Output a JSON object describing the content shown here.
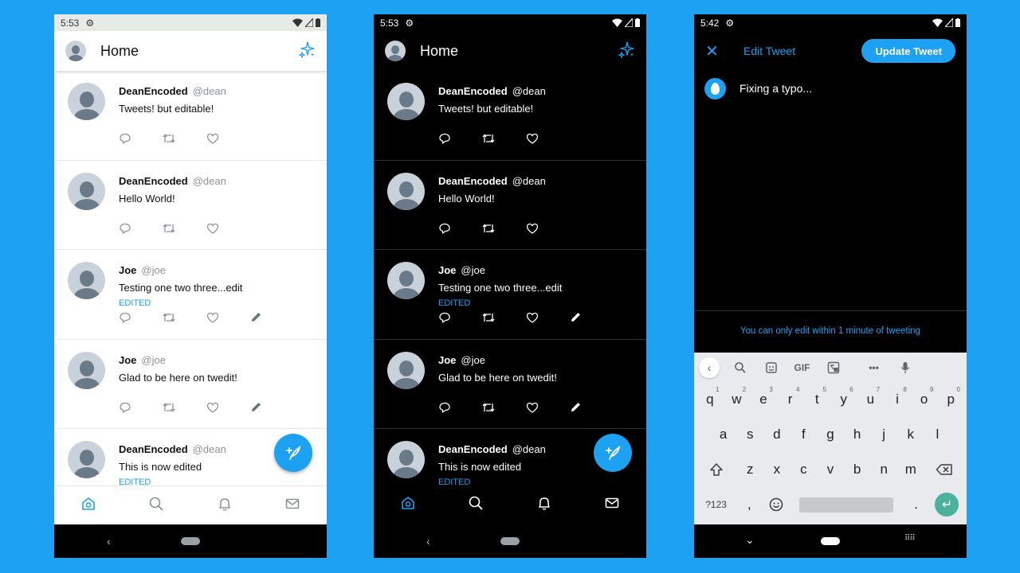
{
  "colors": {
    "accent": "#1da1f2",
    "background": "#1da1f2",
    "light_bg": "#ffffff",
    "dark_bg": "#000000"
  },
  "screen_light": {
    "status": {
      "time": "5:53"
    },
    "appbar": {
      "title": "Home"
    },
    "tweets": [
      {
        "name": "DeanEncoded",
        "handle": "@dean",
        "text": "Tweets! but editable!",
        "edited": "",
        "editable": false
      },
      {
        "name": "DeanEncoded",
        "handle": "@dean",
        "text": "Hello World!",
        "edited": "",
        "editable": false
      },
      {
        "name": "Joe",
        "handle": "@joe",
        "text": "Testing one two three...edit",
        "edited": "EDITED",
        "editable": true
      },
      {
        "name": "Joe",
        "handle": "@joe",
        "text": "Glad to be here on twedit!",
        "edited": "",
        "editable": true
      },
      {
        "name": "DeanEncoded",
        "handle": "@dean",
        "text": "This is now edited",
        "edited": "EDITED",
        "editable": false
      }
    ]
  },
  "screen_dark": {
    "status": {
      "time": "5:53"
    },
    "appbar": {
      "title": "Home"
    },
    "tweets": [
      {
        "name": "DeanEncoded",
        "handle": "@dean",
        "text": "Tweets! but editable!",
        "edited": ""
      },
      {
        "name": "DeanEncoded",
        "handle": "@dean",
        "text": "Hello World!",
        "edited": ""
      },
      {
        "name": "Joe",
        "handle": "@joe",
        "text": "Testing one two three...edit",
        "edited": "EDITED"
      },
      {
        "name": "Joe",
        "handle": "@joe",
        "text": "Glad to be here on twedit!",
        "edited": ""
      },
      {
        "name": "DeanEncoded",
        "handle": "@dean",
        "text": "This is now edited",
        "edited": "EDITED"
      }
    ]
  },
  "screen_edit": {
    "status": {
      "time": "5:42"
    },
    "title": "Edit Tweet",
    "update_label": "Update Tweet",
    "text": "Fixing a typo...",
    "hint": "You can only edit within 1 minute of tweeting",
    "keyboard": {
      "gif_label": "GIF",
      "row1": [
        {
          "k": "q",
          "n": "1"
        },
        {
          "k": "w",
          "n": "2"
        },
        {
          "k": "e",
          "n": "3"
        },
        {
          "k": "r",
          "n": "4"
        },
        {
          "k": "t",
          "n": "5"
        },
        {
          "k": "y",
          "n": "6"
        },
        {
          "k": "u",
          "n": "7"
        },
        {
          "k": "i",
          "n": "8"
        },
        {
          "k": "o",
          "n": "9"
        },
        {
          "k": "p",
          "n": "0"
        }
      ],
      "row2": [
        "a",
        "s",
        "d",
        "f",
        "g",
        "h",
        "j",
        "k",
        "l"
      ],
      "row3": [
        "z",
        "x",
        "c",
        "v",
        "b",
        "n",
        "m"
      ],
      "symbols_label": "?123",
      "comma": ",",
      "period": "."
    }
  },
  "icons": {
    "settings": "gear-icon",
    "compose": "sparkle-icon",
    "reply": "reply-icon",
    "retweet": "retweet-icon",
    "like": "heart-icon",
    "edit": "pencil-icon",
    "home": "home-icon",
    "search": "search-icon",
    "notifications": "bell-icon",
    "messages": "mail-icon"
  }
}
